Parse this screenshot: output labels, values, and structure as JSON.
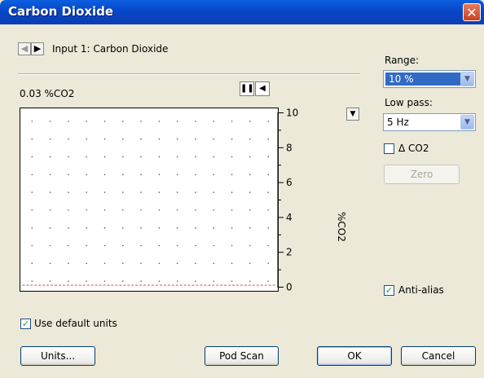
{
  "window": {
    "title": "Carbon Dioxide",
    "close_glyph": "✕"
  },
  "header": {
    "back_glyph": "◀",
    "forward_glyph": "▶",
    "input_title": "Input 1: Carbon Dioxide"
  },
  "readout": {
    "current_value": "0.03 %CO2"
  },
  "plot_controls": {
    "pause_glyph": "❚❚",
    "scroll_glyph": "◀"
  },
  "chart_data": {
    "type": "line",
    "series": [
      {
        "values": [
          0,
          0,
          0,
          0,
          0,
          0,
          0,
          0,
          0,
          0,
          0,
          0,
          0,
          0,
          0,
          0,
          0,
          0,
          0,
          0,
          0
        ]
      }
    ],
    "ylabel": "%CO2",
    "ylim": [
      0,
      10
    ],
    "y_tick_labels": [
      "10",
      "8",
      "6",
      "4",
      "2",
      "0"
    ],
    "grid": "dotted",
    "trace_color": "#D9372B"
  },
  "axis_menu_glyph": "▼",
  "right_panel": {
    "range_label": "Range:",
    "range_value": "10 %",
    "lowpass_label": "Low pass:",
    "lowpass_value": "5 Hz",
    "delta_label": "Δ CO2",
    "delta_checked": false,
    "zero_label": "Zero",
    "antialias_label": "Anti-alias",
    "antialias_checked": true,
    "dropdown_glyph": "▼",
    "check_glyph": "✓"
  },
  "bottom": {
    "default_units_label": "Use default units",
    "default_units_checked": true,
    "units_button": "Units...",
    "pod_scan_button": "Pod Scan",
    "ok_button": "OK",
    "cancel_button": "Cancel"
  },
  "colors": {
    "titlebar": "#0A5FE0",
    "selection": "#316AC5",
    "dialog_bg": "#ECE9D8"
  }
}
